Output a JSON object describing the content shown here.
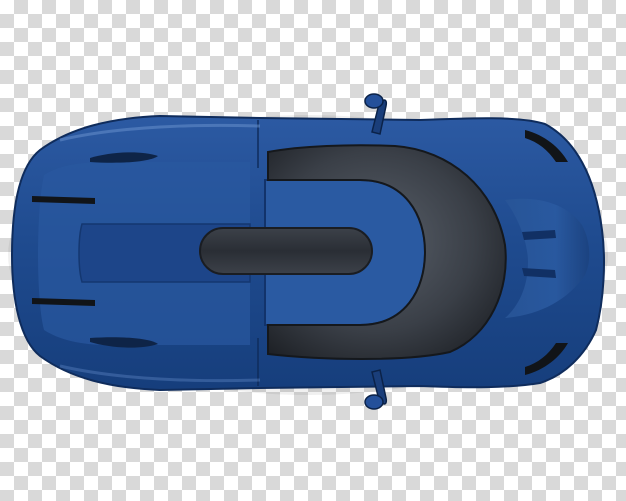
{
  "image": {
    "background": "transparency-checkerboard",
    "subject": "top-view-sports-car",
    "colors": {
      "checker_light": "#ffffff",
      "checker_dark": "#d9d9d9",
      "body_blue": "#1f4b8f",
      "body_dark": "#12336b",
      "body_highlight": "#5f86c4",
      "glass_dark": "#2b2f36",
      "glass_mid": "#4a5058",
      "trim_black": "#111418"
    }
  }
}
